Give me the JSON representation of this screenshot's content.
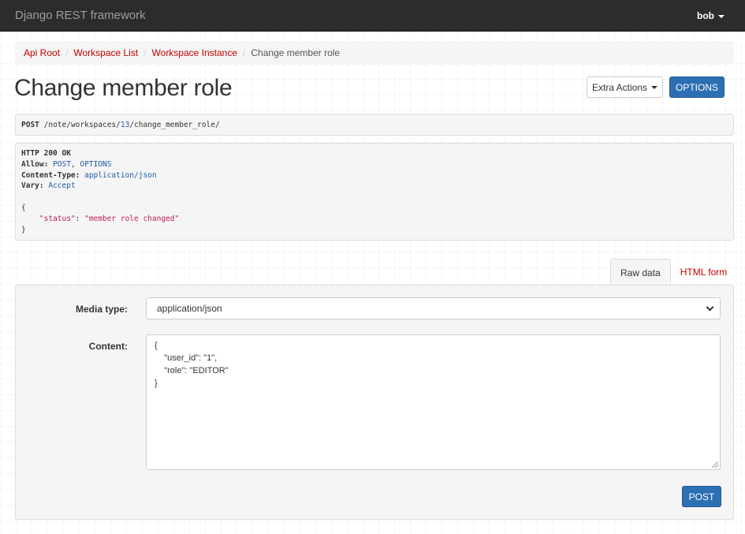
{
  "navbar": {
    "brand": "Django REST framework",
    "user": "bob"
  },
  "breadcrumb": [
    {
      "label": "Api Root"
    },
    {
      "label": "Workspace List"
    },
    {
      "label": "Workspace Instance"
    },
    {
      "label": "Change member role"
    }
  ],
  "page_title": "Change member role",
  "buttons": {
    "extra_actions": "Extra Actions",
    "options": "OPTIONS",
    "post": "POST"
  },
  "request": {
    "method": "POST",
    "path_prefix": "/note/workspaces/",
    "path_id": "13",
    "path_suffix": "/change_member_role/"
  },
  "response": {
    "status_line": "HTTP 200 OK",
    "allow_key": "Allow:",
    "allow_post": "POST",
    "allow_sep": ",",
    "allow_options": "OPTIONS",
    "ctype_key": "Content-Type:",
    "ctype_val": "application/json",
    "vary_key": "Vary:",
    "vary_val": "Accept",
    "body_open": "{",
    "body_key": "\"status\"",
    "body_colon": ": ",
    "body_value": "\"member role changed\"",
    "body_close": "}"
  },
  "tabs": [
    {
      "label": "Raw data",
      "active": true
    },
    {
      "label": "HTML form",
      "active": false
    }
  ],
  "form": {
    "media_type_label": "Media type:",
    "media_type_value": "application/json",
    "content_label": "Content:",
    "content_lines": [
      "{",
      "    \"user_id\": \"1\",",
      "    \"role\": \"EDITOR\"",
      "}"
    ]
  },
  "colors": {
    "navbar": "#2c2c2c",
    "link": "#c20000",
    "primary": "#2c6fb3"
  }
}
